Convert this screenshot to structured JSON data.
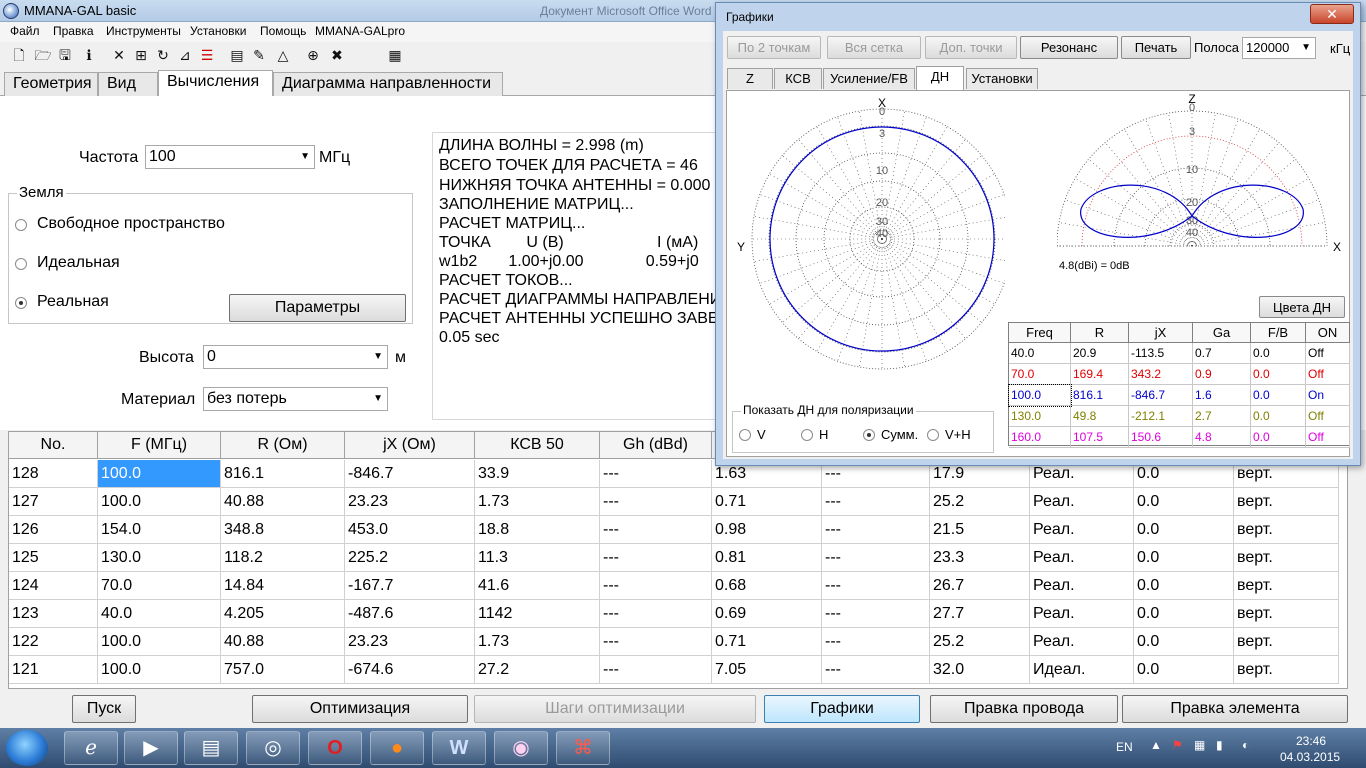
{
  "app": {
    "title": "MMANA-GAL basic",
    "background_title": "Документ Microsoft Office Word"
  },
  "menu": [
    "Файл",
    "Правка",
    "Инструменты",
    "Установки",
    "Помощь",
    "MMANA-GALpro"
  ],
  "toolbar_icons": [
    "new-file-icon",
    "open-folder-icon",
    "save-icon",
    "info-icon",
    "wire-icon",
    "grid-icon",
    "rotate-icon",
    "element-icon",
    "page-icon",
    "edit-icon",
    "triangle-icon",
    "target-icon",
    "tools-icon",
    "calculator-icon"
  ],
  "main_tabs": [
    "Геометрия",
    "Вид",
    "Вычисления",
    "Диаграмма направленности"
  ],
  "calc": {
    "freq_label": "Частота",
    "freq_value": "100",
    "freq_unit": "МГц",
    "ground_title": "Земля",
    "ground_options": [
      "Свободное пространство",
      "Идеальная",
      "Реальная"
    ],
    "params_button": "Параметры",
    "height_label": "Высота",
    "height_value": "0",
    "height_unit": "м",
    "material_label": "Материал",
    "material_value": "без потерь"
  },
  "log_lines": [
    "ДЛИНА ВОЛНЫ = 2.998 (m)",
    "ВСЕГО ТОЧЕК ДЛЯ РАСЧЕТА = 46",
    "НИЖНЯЯ ТОЧКА АНТЕННЫ = 0.000",
    "ЗАПОЛНЕНИЕ МАТРИЦ...",
    "РАСЧЕТ МАТРИЦ...",
    "ТОЧКА        U (В)                     I (мА)",
    "w1b2       1.00+j0.00              0.59+j0",
    "РАСЧЕТ ТОКОВ...",
    "РАСЧЕТ ДИАГРАММЫ НАПРАВЛЕНИ",
    "РАСЧЕТ АНТЕННЫ УСПЕШНО ЗАВЕ",
    "0.05 sec"
  ],
  "main_table": {
    "headers": [
      "No.",
      "F (МГц)",
      "R (Ом)",
      "jX (Ом)",
      "КСВ 50",
      "Gh (dBd)",
      "",
      "",
      "",
      "",
      "",
      ""
    ],
    "rows": [
      [
        "128",
        "100.0",
        "816.1",
        "-846.7",
        "33.9",
        "---",
        "1.63",
        "---",
        "17.9",
        "Реал.",
        "0.0",
        "верт."
      ],
      [
        "127",
        "100.0",
        "40.88",
        "23.23",
        "1.73",
        "---",
        "0.71",
        "---",
        "25.2",
        "Реал.",
        "0.0",
        "верт."
      ],
      [
        "126",
        "154.0",
        "348.8",
        "453.0",
        "18.8",
        "---",
        "0.98",
        "---",
        "21.5",
        "Реал.",
        "0.0",
        "верт."
      ],
      [
        "125",
        "130.0",
        "118.2",
        "225.2",
        "11.3",
        "---",
        "0.81",
        "---",
        "23.3",
        "Реал.",
        "0.0",
        "верт."
      ],
      [
        "124",
        "70.0",
        "14.84",
        "-167.7",
        "41.6",
        "---",
        "0.68",
        "---",
        "26.7",
        "Реал.",
        "0.0",
        "верт."
      ],
      [
        "123",
        "40.0",
        "4.205",
        "-487.6",
        "1142",
        "---",
        "0.69",
        "---",
        "27.7",
        "Реал.",
        "0.0",
        "верт."
      ],
      [
        "122",
        "100.0",
        "40.88",
        "23.23",
        "1.73",
        "---",
        "0.71",
        "---",
        "25.2",
        "Реал.",
        "0.0",
        "верт."
      ],
      [
        "121",
        "100.0",
        "757.0",
        "-674.6",
        "27.2",
        "---",
        "7.05",
        "---",
        "32.0",
        "Идеал.",
        "0.0",
        "верт."
      ]
    ]
  },
  "bottom_buttons": [
    "Пуск",
    "Оптимизация",
    "Шаги оптимизации",
    "Графики",
    "Правка провода",
    "Правка элемента"
  ],
  "graphs": {
    "title": "Графики",
    "close": "✕",
    "buttons": [
      "По 2 точкам",
      "Вся сетка",
      "Доп. точки",
      "Резонанс",
      "Печать"
    ],
    "band_label": "Полоса",
    "band_value": "120000",
    "band_unit": "кГц",
    "tabs": [
      "Z",
      "КСВ",
      "Усиление/FB",
      "ДН",
      "Установки"
    ],
    "left_plot": {
      "axis_top": "X",
      "axis_left": "Y",
      "rings": [
        "0",
        "3",
        "10",
        "20",
        "30",
        "40"
      ]
    },
    "right_plot": {
      "axis_top": "Z",
      "axis_right": "X",
      "rings": [
        "0",
        "3",
        "10",
        "20",
        "30",
        "40"
      ]
    },
    "gain_note": "4.8(dBi) = 0dB",
    "colors_button": "Цвета ДН",
    "table": {
      "headers": [
        "Freq",
        "R",
        "jX",
        "Ga",
        "F/B",
        "ON"
      ],
      "rows": [
        {
          "cells": [
            "40.0",
            "20.9",
            "-113.5",
            "0.7",
            "0.0",
            "Off"
          ],
          "color": "#000000"
        },
        {
          "cells": [
            "70.0",
            "169.4",
            "343.2",
            "0.9",
            "0.0",
            "Off"
          ],
          "color": "#e00000"
        },
        {
          "cells": [
            "100.0",
            "816.1",
            "-846.7",
            "1.6",
            "0.0",
            "On"
          ],
          "color": "#0000cc"
        },
        {
          "cells": [
            "130.0",
            "49.8",
            "-212.1",
            "2.7",
            "0.0",
            "Off"
          ],
          "color": "#808000"
        },
        {
          "cells": [
            "160.0",
            "107.5",
            "150.6",
            "4.8",
            "0.0",
            "Off"
          ],
          "color": "#e000e0"
        }
      ]
    },
    "polarization_title": "Показать ДН для поляризации",
    "polarization_options": [
      "V",
      "H",
      "Сумм.",
      "V+H"
    ]
  },
  "taskbar": {
    "apps": [
      "ie-icon",
      "media-player-icon",
      "files-icon",
      "chrome-icon",
      "opera-icon",
      "firefox-icon",
      "word-icon",
      "mmana-icon",
      "pdf-icon"
    ],
    "lang": "EN",
    "time": "23:46",
    "date": "04.03.2015"
  },
  "accent": "#3399ff",
  "pattern_color": "#0000cc"
}
